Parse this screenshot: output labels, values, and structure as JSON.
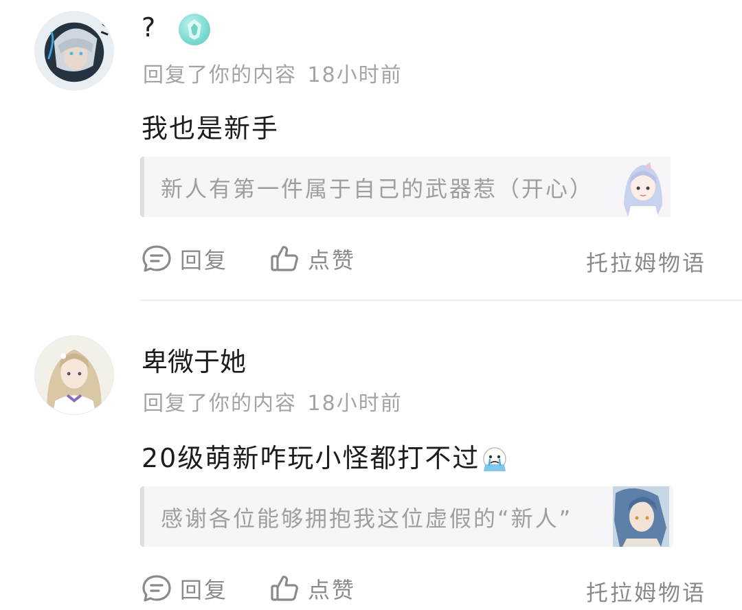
{
  "notifications": [
    {
      "user_name": "?",
      "user_badge_icon": "teal-level-badge-icon",
      "action_text": "回复了你的内容",
      "time": "18小时前",
      "reply_text": "我也是新手",
      "reply_emoji": "",
      "quoted_text": "新人有第一件属于自己的武器惹（开心）",
      "reply_label": "回复",
      "like_label": "点赞",
      "source": "托拉姆物语"
    },
    {
      "user_name": "卑微于她",
      "action_text": "回复了你的内容",
      "time": "18小时前",
      "reply_text": "20级萌新咋玩小怪都打不过",
      "reply_emoji": "crying-face-emoji",
      "quoted_text": "感谢各位能够拥抱我这位虚假的“新人”",
      "reply_label": "回复",
      "like_label": "点赞",
      "source": "托拉姆物语"
    }
  ],
  "colors": {
    "text_primary": "#1c1c1c",
    "text_secondary": "#a3a3a3",
    "quote_bg": "#f6f6f8",
    "quote_bar": "#dedee3",
    "divider": "#ececec",
    "badge": "#7fdcd2"
  }
}
